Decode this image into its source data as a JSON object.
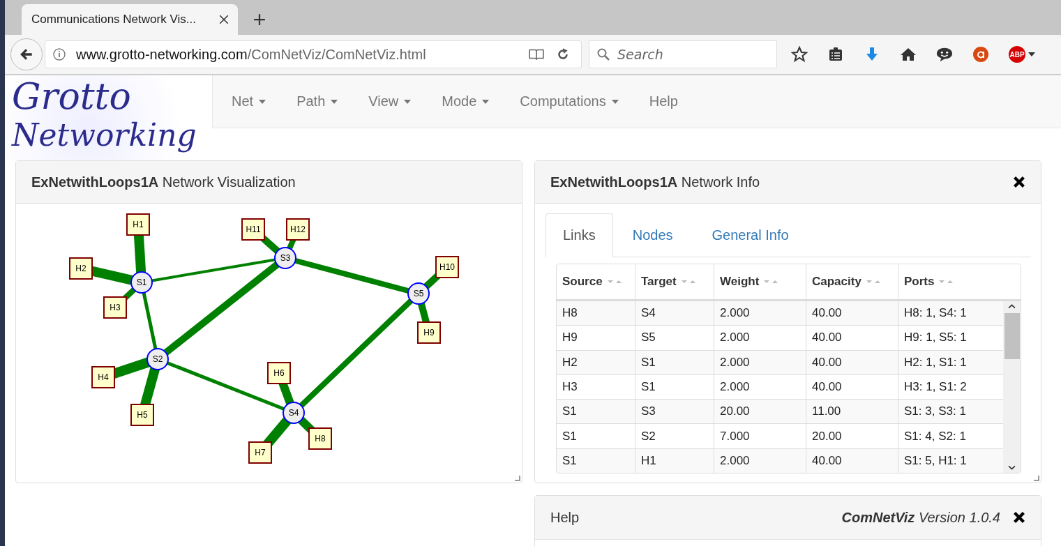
{
  "browser": {
    "tabs": [
      {
        "title": "Communications Network Vis...",
        "selected": true
      }
    ],
    "url_domain": "www.grotto-networking.com",
    "url_path": "/ComNetViz/ComNetViz.html",
    "search_placeholder": "Search",
    "addon_badge": "ABP"
  },
  "logo": {
    "line1": "Grotto",
    "line2": "Networking"
  },
  "navbar": [
    {
      "label": "Net",
      "dropdown": true
    },
    {
      "label": "Path",
      "dropdown": true
    },
    {
      "label": "View",
      "dropdown": true
    },
    {
      "label": "Mode",
      "dropdown": true
    },
    {
      "label": "Computations",
      "dropdown": true
    },
    {
      "label": "Help",
      "dropdown": false
    }
  ],
  "viz_panel": {
    "title": "**ExNetwithLoops1A** Network Visualization",
    "nodes": [
      {
        "label": "S1",
        "kind": "switch"
      },
      {
        "label": "S2",
        "kind": "switch"
      },
      {
        "label": "S3",
        "kind": "switch"
      },
      {
        "label": "S4",
        "kind": "switch"
      },
      {
        "label": "S5",
        "kind": "switch"
      },
      {
        "label": "H1",
        "kind": "host"
      },
      {
        "label": "H2",
        "kind": "host"
      },
      {
        "label": "H3",
        "kind": "host"
      },
      {
        "label": "H4",
        "kind": "host"
      },
      {
        "label": "H5",
        "kind": "host"
      },
      {
        "label": "H6",
        "kind": "host"
      },
      {
        "label": "H7",
        "kind": "host"
      },
      {
        "label": "H8",
        "kind": "host"
      },
      {
        "label": "H9",
        "kind": "host"
      },
      {
        "label": "H10",
        "kind": "host"
      },
      {
        "label": "H11",
        "kind": "host"
      },
      {
        "label": "H12",
        "kind": "host"
      }
    ]
  },
  "info_panel": {
    "title": "**ExNetwithLoops1A** Network Info",
    "tabs": [
      {
        "label": "Links",
        "selected": true
      },
      {
        "label": "Nodes",
        "selected": false
      },
      {
        "label": "General Info",
        "selected": false
      }
    ],
    "columns": [
      "Source",
      "Target",
      "Weight",
      "Capacity",
      "Ports"
    ],
    "rows": [
      [
        "H8",
        "S4",
        "2.000",
        "40.00",
        "H8: 1, S4: 1"
      ],
      [
        "H9",
        "S5",
        "2.000",
        "40.00",
        "H9: 1, S5: 1"
      ],
      [
        "H2",
        "S1",
        "2.000",
        "40.00",
        "H2: 1, S1: 1"
      ],
      [
        "H3",
        "S1",
        "2.000",
        "40.00",
        "H3: 1, S1: 2"
      ],
      [
        "S1",
        "S3",
        "20.00",
        "11.00",
        "S1: 3, S3: 1"
      ],
      [
        "S1",
        "S2",
        "7.000",
        "20.00",
        "S1: 4, S2: 1"
      ],
      [
        "S1",
        "H1",
        "2.000",
        "40.00",
        "S1: 5, H1: 1"
      ]
    ]
  },
  "help_panel": {
    "title": "Help",
    "version": "**ComNetViz** Version 1.0.4"
  }
}
